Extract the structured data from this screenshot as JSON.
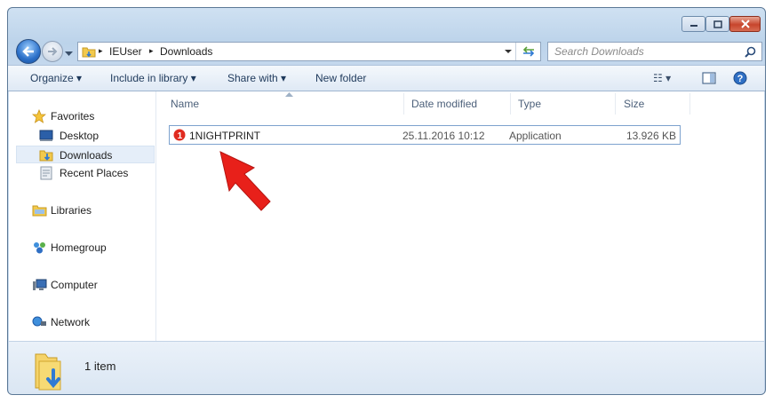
{
  "window": {
    "caption_buttons": [
      "minimize",
      "maximize",
      "close"
    ]
  },
  "address_bar": {
    "breadcrumbs": [
      "IEUser",
      "Downloads"
    ]
  },
  "search": {
    "placeholder": "Search Downloads"
  },
  "toolbar": {
    "organize": "Organize ▾",
    "include": "Include in library ▾",
    "share": "Share with ▾",
    "new_folder": "New folder",
    "view_glyph": "☷ ▾"
  },
  "sidebar": {
    "favorites": "Favorites",
    "desktop": "Desktop",
    "downloads": "Downloads",
    "recent": "Recent Places",
    "libraries": "Libraries",
    "homegroup": "Homegroup",
    "computer": "Computer",
    "network": "Network"
  },
  "columns": {
    "name": "Name",
    "date": "Date modified",
    "type": "Type",
    "size": "Size"
  },
  "files": [
    {
      "name": "1NIGHTPRINT",
      "date": "25.11.2016 10:12",
      "type": "Application",
      "size": "13.926 KB"
    }
  ],
  "status": {
    "count": "1 item"
  },
  "colors": {
    "arrow": "#e8201a",
    "selection": "#e5eef9"
  }
}
